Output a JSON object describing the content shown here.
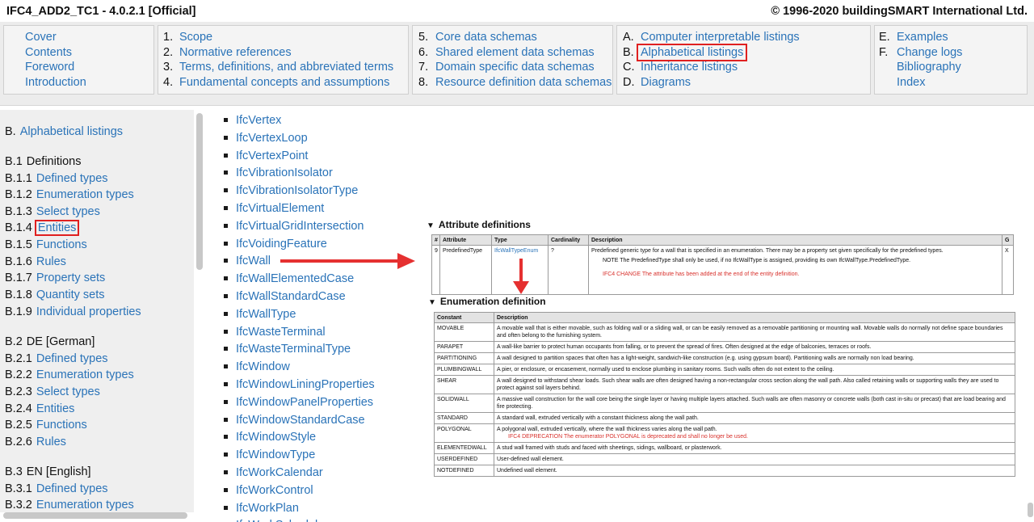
{
  "title_bar": {
    "title": "IFC4_ADD2_TC1 - 4.0.2.1 [Official]",
    "copyright": "© 1996-2020 buildingSMART International Ltd."
  },
  "nav": {
    "col1": [
      {
        "num": "",
        "label": "Cover"
      },
      {
        "num": "",
        "label": "Contents"
      },
      {
        "num": "",
        "label": "Foreword"
      },
      {
        "num": "",
        "label": "Introduction"
      }
    ],
    "col2": [
      {
        "num": "1.",
        "label": "Scope"
      },
      {
        "num": "2.",
        "label": "Normative references"
      },
      {
        "num": "3.",
        "label": "Terms, definitions, and abbreviated terms"
      },
      {
        "num": "4.",
        "label": "Fundamental concepts and assumptions"
      }
    ],
    "col3": [
      {
        "num": "5.",
        "label": "Core data schemas"
      },
      {
        "num": "6.",
        "label": "Shared element data schemas"
      },
      {
        "num": "7.",
        "label": "Domain specific data schemas"
      },
      {
        "num": "8.",
        "label": "Resource definition data schemas"
      }
    ],
    "col4": [
      {
        "num": "A.",
        "label": "Computer interpretable listings"
      },
      {
        "num": "B.",
        "label": "Alphabetical listings"
      },
      {
        "num": "C.",
        "label": "Inheritance listings"
      },
      {
        "num": "D.",
        "label": "Diagrams"
      }
    ],
    "col5": [
      {
        "num": "E.",
        "label": "Examples"
      },
      {
        "num": "F.",
        "label": "Change logs"
      },
      {
        "num": "",
        "label": "Bibliography"
      },
      {
        "num": "",
        "label": "Index"
      }
    ]
  },
  "sidebar": {
    "heading_num": "B.",
    "heading_label": "Alphabetical listings",
    "items": [
      {
        "num": "B.1",
        "label": "Definitions",
        "link": false
      },
      {
        "num": "B.1.1",
        "label": "Defined types",
        "link": true
      },
      {
        "num": "B.1.2",
        "label": "Enumeration types",
        "link": true
      },
      {
        "num": "B.1.3",
        "label": "Select types",
        "link": true
      },
      {
        "num": "B.1.4",
        "label": "Entities",
        "link": true
      },
      {
        "num": "B.1.5",
        "label": "Functions",
        "link": true
      },
      {
        "num": "B.1.6",
        "label": "Rules",
        "link": true
      },
      {
        "num": "B.1.7",
        "label": "Property sets",
        "link": true
      },
      {
        "num": "B.1.8",
        "label": "Quantity sets",
        "link": true
      },
      {
        "num": "B.1.9",
        "label": "Individual properties",
        "link": true
      },
      {
        "num": "B.2",
        "label": "DE [German]",
        "link": false
      },
      {
        "num": "B.2.1",
        "label": "Defined types",
        "link": true
      },
      {
        "num": "B.2.2",
        "label": "Enumeration types",
        "link": true
      },
      {
        "num": "B.2.3",
        "label": "Select types",
        "link": true
      },
      {
        "num": "B.2.4",
        "label": "Entities",
        "link": true
      },
      {
        "num": "B.2.5",
        "label": "Functions",
        "link": true
      },
      {
        "num": "B.2.6",
        "label": "Rules",
        "link": true
      },
      {
        "num": "B.3",
        "label": "EN [English]",
        "link": false
      },
      {
        "num": "B.3.1",
        "label": "Defined types",
        "link": true
      },
      {
        "num": "B.3.2",
        "label": "Enumeration types",
        "link": true
      }
    ]
  },
  "entities": [
    "IfcVertex",
    "IfcVertexLoop",
    "IfcVertexPoint",
    "IfcVibrationIsolator",
    "IfcVibrationIsolatorType",
    "IfcVirtualElement",
    "IfcVirtualGridIntersection",
    "IfcVoidingFeature",
    "IfcWall",
    "IfcWallElementedCase",
    "IfcWallStandardCase",
    "IfcWallType",
    "IfcWasteTerminal",
    "IfcWasteTerminalType",
    "IfcWindow",
    "IfcWindowLiningProperties",
    "IfcWindowPanelProperties",
    "IfcWindowStandardCase",
    "IfcWindowStyle",
    "IfcWindowType",
    "IfcWorkCalendar",
    "IfcWorkControl",
    "IfcWorkPlan",
    "IfcWorkSchedule"
  ],
  "attributes": {
    "title": "Attribute definitions",
    "headers": [
      "#",
      "Attribute",
      "Type",
      "Cardinality",
      "Description",
      "G"
    ],
    "row": {
      "num": "9",
      "attribute": "PredefinedType",
      "type": "IfcWallTypeEnum",
      "cardinality": "?",
      "description": "Predefined generic type for a wall that is specified in an enumeration. There may be a property set given specifically for the predefined types.",
      "note": "NOTE  The PredefinedType shall only be used, if no IfcWallType is assigned, providing its own IfcWallType.PredefinedType.",
      "change": "IFC4 CHANGE  The attribute has been added at the end of the entity definition.",
      "g": "X"
    }
  },
  "enumeration": {
    "title": "Enumeration definition",
    "headers": [
      "Constant",
      "Description"
    ],
    "rows": [
      {
        "constant": "MOVABLE",
        "description": "A movable wall that is either movable, such as folding wall or a sliding wall, or can be easily removed as a removable partitioning or mounting wall. Movable walls do normally not define space boundaries and often belong to the furnishing system."
      },
      {
        "constant": "PARAPET",
        "description": "A wall-like barrier to protect human occupants from falling, or to prevent the spread of fires. Often designed at the edge of balconies, terraces or roofs."
      },
      {
        "constant": "PARTITIONING",
        "description": "A wall designed to partition spaces that often has a light-weight, sandwich-like construction (e.g. using gypsum board). Partitioning walls are normally non load bearing."
      },
      {
        "constant": "PLUMBINGWALL",
        "description": "A pier, or enclosure, or encasement, normally used to enclose plumbing in sanitary rooms. Such walls often do not extent to the ceiling."
      },
      {
        "constant": "SHEAR",
        "description": "A wall designed to withstand shear loads. Such shear walls are often designed having a non-rectangular cross section along the wall path. Also called retaining walls or supporting walls they are used to protect against soil layers behind."
      },
      {
        "constant": "SOLIDWALL",
        "description": "A massive wall construction for the wall core being the single layer or having multiple layers attached. Such walls are often masonry or concrete walls (both cast in-situ or precast) that are load bearing and fire protecting."
      },
      {
        "constant": "STANDARD",
        "description": "A standard wall, extruded vertically with a constant thickness along the wall path."
      },
      {
        "constant": "POLYGONAL",
        "description": "A polygonal wall, extruded vertically, where the wall thickness varies along the wall path.",
        "deprecation": "IFC4 DEPRECATION  The enumerator POLYGONAL is deprecated and shall no longer be used."
      },
      {
        "constant": "ELEMENTEDWALL",
        "description": "A stud wall framed with studs and faced with sheetings, sidings, wallboard, or plasterwork."
      },
      {
        "constant": "USERDEFINED",
        "description": "User-defined wall element."
      },
      {
        "constant": "NOTDEFINED",
        "description": "Undefined wall element."
      }
    ]
  },
  "colors": {
    "link": "#2a73b8",
    "highlight": "#e02020",
    "arrow": "#e53030",
    "change_text": "#d8312c"
  }
}
